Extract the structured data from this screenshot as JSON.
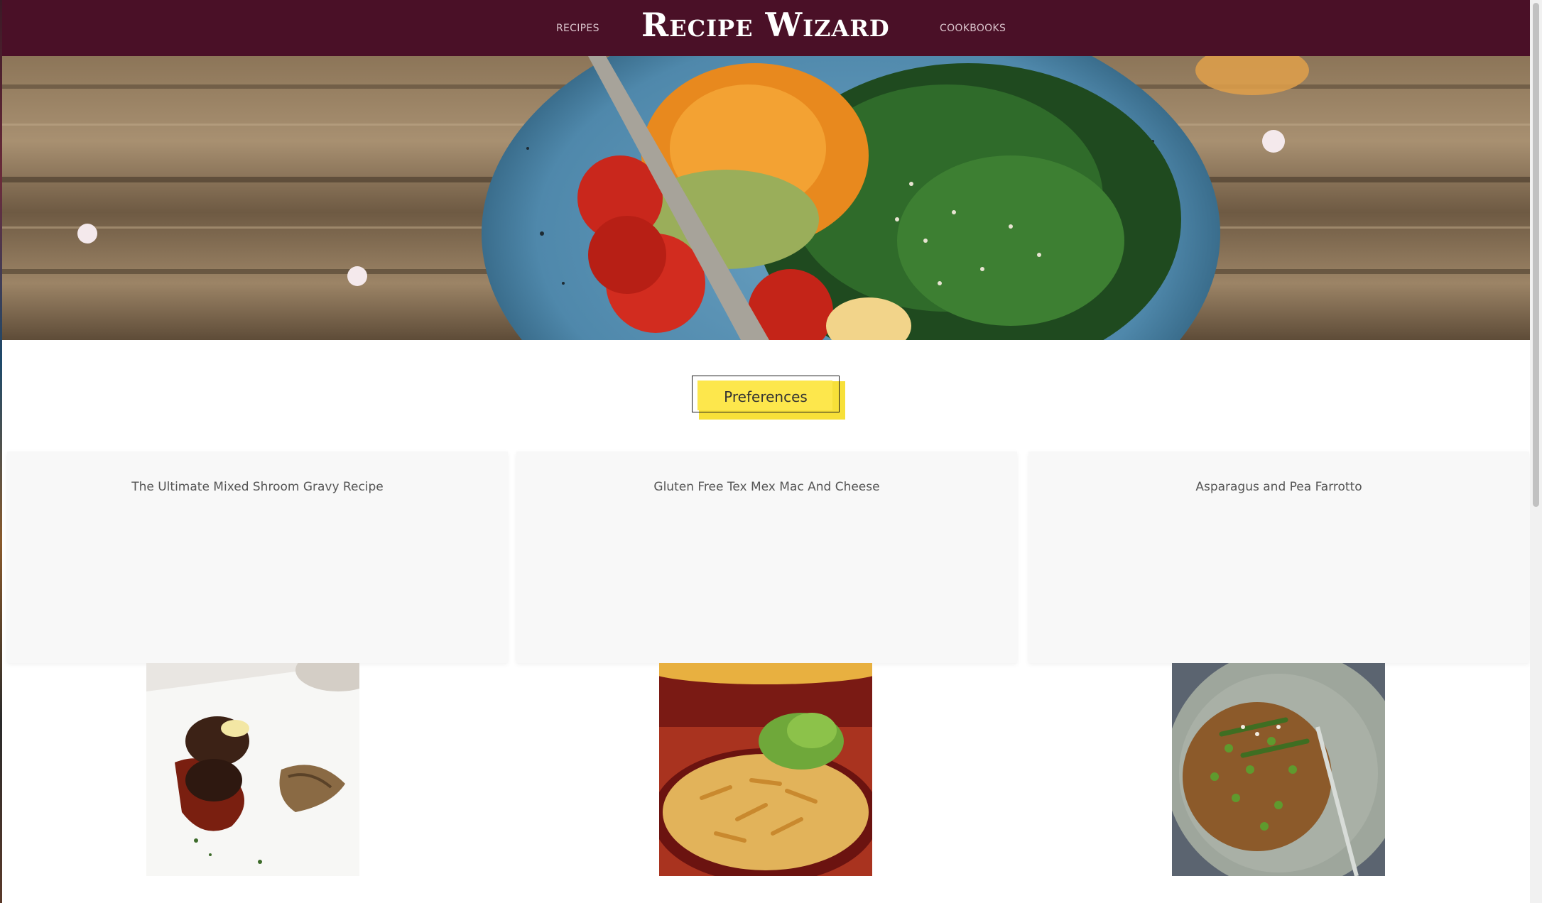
{
  "nav": {
    "left_link": "RECIPES",
    "brand": "Recipe Wizard",
    "right_link": "COOKBOOKS",
    "bg_color": "#4a1027"
  },
  "hero": {
    "image": "salad-bowl-on-wooden-table"
  },
  "preferences": {
    "label": "Preferences",
    "accent_color": "#fde74c"
  },
  "recipes": [
    {
      "title": "The Ultimate Mixed Shroom Gravy Recipe",
      "image": "steak-with-mushroom-gravy"
    },
    {
      "title": "Gluten Free Tex Mex Mac And Cheese",
      "image": "penne-mac-and-cheese"
    },
    {
      "title": "Asparagus and Pea Farrotto",
      "image": "asparagus-pea-farrotto"
    }
  ]
}
